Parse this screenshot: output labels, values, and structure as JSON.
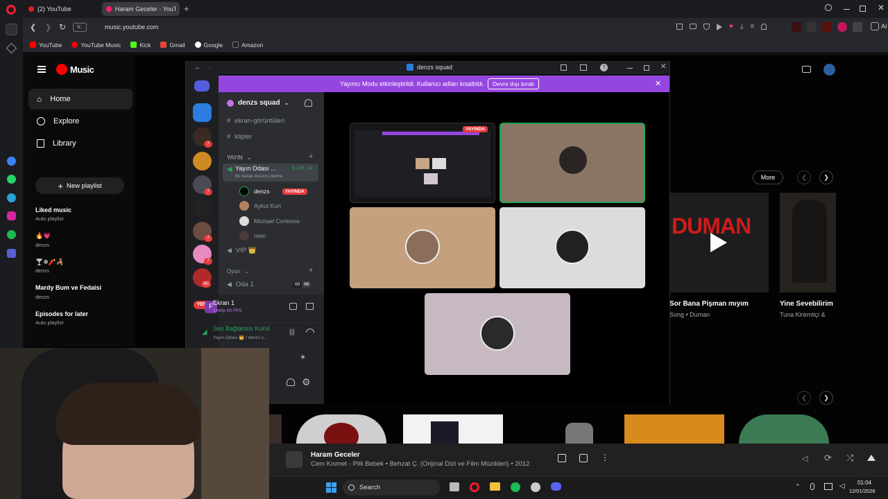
{
  "browser": {
    "tabs": [
      "(2) YouTube",
      "Haram Geceler - YouT"
    ],
    "url": "music.youtube.com",
    "site_chip": "V..",
    "bookmarks": [
      "YouTube",
      "YouTube Music",
      "Kick",
      "Gmail",
      "Google",
      "Amazon"
    ],
    "ai_label": "AI",
    "colors": {
      "opera_red": "#ff1b2d",
      "youtube_red": "#ff0000"
    }
  },
  "ytmusic": {
    "logo": "Music",
    "nav": [
      "Home",
      "Explore",
      "Library"
    ],
    "new_playlist": "New playlist",
    "playlists": [
      {
        "title": "Liked music",
        "sub": "Auto playlist"
      },
      {
        "title": "🔥💗",
        "sub": "denzs"
      },
      {
        "title": "🍸❄🧨🦂",
        "sub": "denzs"
      },
      {
        "title": "Mardy Bum ve Fedaisi",
        "sub": "denzs"
      },
      {
        "title": "Episodes for later",
        "sub": "Auto playlist"
      }
    ],
    "more": "More",
    "cards": [
      {
        "big_text": "DUMAN",
        "title": "Sor Bana Pişman mıyım",
        "sub": "Song • Duman"
      },
      {
        "title": "Yine Sevebilirim",
        "sub": "Tuna Kiremitçi &"
      }
    ]
  },
  "discord": {
    "window_title": "denzs squad",
    "banner_text": "Yayıncı Modu etkinleştirildi. Kullanıcı adları kısaltıldı.",
    "banner_button": "Devre dışı bırak",
    "server_name": "denzs squad",
    "channels": [
      "ekran-görüntüleri",
      "klipler"
    ],
    "category_stream": "YAYIN",
    "voice_channel": "Yayın Odası ...",
    "voice_timer": "6:20:14",
    "voice_sub": "Bir kanal durumu belirle",
    "users": [
      "denzs",
      "Aykut Kurt",
      "Michael Corleone",
      "rean"
    ],
    "live_badge": "YAYINDA",
    "vip": "VIP 👑",
    "category_game": "Oyun",
    "game_room": "Oda 1",
    "game_counts": [
      "00",
      "99"
    ],
    "new_badge": "YENİ",
    "screen_name": "Ekran 1",
    "screen_sub": "1440p 60 FPS",
    "screen_icon_letter": "F",
    "voice_status": "Ses Bağlantısı Kurul",
    "voice_status_sub": "Yayın Odası 👑 / denzs s...",
    "server_badges": [
      "7",
      "7",
      "7",
      "7",
      "60"
    ],
    "colors": {
      "brand": "#5865f2",
      "banner": "#9646e0",
      "green": "#23a55a",
      "red": "#e63b3b"
    }
  },
  "player": {
    "title": "Haram Geceler",
    "subtitle": "Cem Kısmet - Pilli Bebek • Behzat Ç. (Orijinal Dizi ve Film Müzikleri) • 2012"
  },
  "taskbar": {
    "search": "Search",
    "time": "01:04",
    "date": "12/01/2026"
  }
}
